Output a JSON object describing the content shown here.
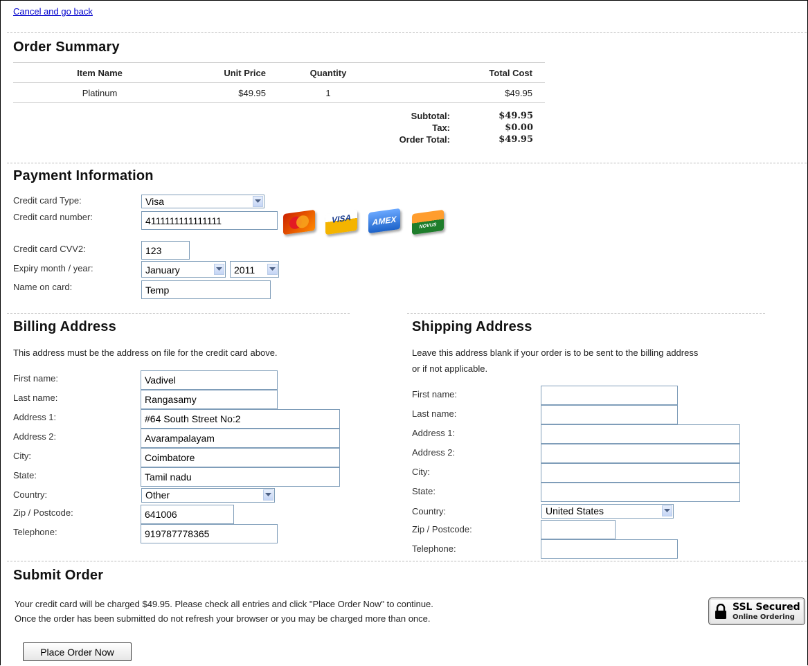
{
  "nav": {
    "cancel_link": "Cancel and go back"
  },
  "order_summary": {
    "title": "Order Summary",
    "columns": [
      "Item Name",
      "Unit Price",
      "Quantity",
      "Total Cost"
    ],
    "rows": [
      {
        "item": "Platinum",
        "unit_price": "$49.95",
        "quantity": "1",
        "total": "$49.95"
      }
    ],
    "subtotal_label": "Subtotal:",
    "subtotal": "$49.95",
    "tax_label": "Tax:",
    "tax": "$0.00",
    "order_total_label": "Order Total:",
    "order_total": "$49.95"
  },
  "payment": {
    "title": "Payment Information",
    "card_type_label": "Credit card Type:",
    "card_type": "Visa",
    "card_number_label": "Credit card number:",
    "card_number": "4111111111111111",
    "cards": [
      "MasterCard",
      "VISA",
      "AMEX",
      "DISCOVER NOVUS"
    ],
    "cvv_label": "Credit card CVV2:",
    "cvv": "123",
    "expiry_label": "Expiry month / year:",
    "expiry_month": "January",
    "expiry_year": "2011",
    "name_label": "Name on card:",
    "name": "Temp"
  },
  "billing": {
    "title": "Billing Address",
    "note": "This address must be the address on file for the credit card above.",
    "labels": {
      "first": "First name:",
      "last": "Last name:",
      "addr1": "Address 1:",
      "addr2": "Address 2:",
      "city": "City:",
      "state": "State:",
      "country": "Country:",
      "zip": "Zip / Postcode:",
      "phone": "Telephone:"
    },
    "values": {
      "first": "Vadivel",
      "last": "Rangasamy",
      "addr1": "#64 South Street No:2",
      "addr2": "Avarampalayam",
      "city": "Coimbatore",
      "state": "Tamil nadu",
      "country": "Other",
      "zip": "641006",
      "phone": "919787778365"
    }
  },
  "shipping": {
    "title": "Shipping Address",
    "note_line1": "Leave this address blank if your order is to be sent to the billing address",
    "note_line2": "or if not applicable.",
    "labels": {
      "first": "First name:",
      "last": "Last name:",
      "addr1": "Address 1:",
      "addr2": "Address 2:",
      "city": "City:",
      "state": "State:",
      "country": "Country:",
      "zip": "Zip / Postcode:",
      "phone": "Telephone:"
    },
    "values": {
      "first": "",
      "last": "",
      "addr1": "",
      "addr2": "",
      "city": "",
      "state": "",
      "country": "United States",
      "zip": "",
      "phone": ""
    }
  },
  "submit": {
    "title": "Submit Order",
    "line1": "Your credit card will be charged $49.95. Please check all entries and click \"Place Order Now\" to continue.",
    "line2": "Once the order has been submitted do not refresh your browser or you may be charged more than once.",
    "button": "Place Order Now",
    "ssl_line1": "SSL Secured",
    "ssl_line2": "Online Ordering"
  }
}
